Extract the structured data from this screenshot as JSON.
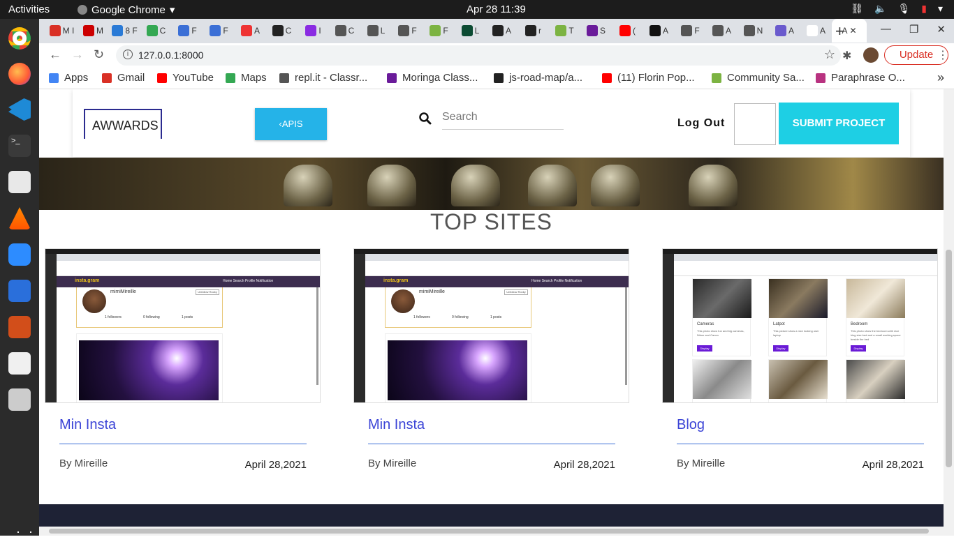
{
  "os": {
    "activities": "Activities",
    "app_name": "Google Chrome",
    "datetime": "Apr 28  11:39"
  },
  "browser": {
    "url": "127.0.0.1:8000",
    "update_label": "Update",
    "tabs": [
      "M I",
      "M",
      "8 F",
      "C",
      "F",
      "F",
      "A",
      "C",
      "I",
      "C",
      "L",
      "F",
      "F",
      "L",
      "A",
      "r",
      "T",
      "S",
      "(",
      "A",
      "F",
      "A",
      "N",
      "A",
      "A"
    ],
    "active_tab": "A"
  },
  "bookmarks": [
    {
      "label": "Apps",
      "icon": "apps-grid-icon",
      "color": "#4285f4"
    },
    {
      "label": "Gmail",
      "icon": "gmail-icon",
      "color": "#d93025"
    },
    {
      "label": "YouTube",
      "icon": "youtube-icon",
      "color": "#ff0000"
    },
    {
      "label": "Maps",
      "icon": "maps-icon",
      "color": "#34a853"
    },
    {
      "label": "repl.it - Classr...",
      "icon": "replit-icon",
      "color": "#555555"
    },
    {
      "label": "Moringa Class...",
      "icon": "moringa-icon",
      "color": "#6a1b9a"
    },
    {
      "label": "js-road-map/a...",
      "icon": "github-icon",
      "color": "#222222"
    },
    {
      "label": "(11) Florin Pop...",
      "icon": "youtube-icon",
      "color": "#ff0000"
    },
    {
      "label": "Community Sa...",
      "icon": "community-icon",
      "color": "#7cb342"
    },
    {
      "label": "Paraphrase O...",
      "icon": "paraphrase-icon",
      "color": "#b83280"
    }
  ],
  "site": {
    "logo": "AWWARDS",
    "apis_button": "APIS",
    "search_placeholder": "Search",
    "logout": "Log Out",
    "submit_button": "SUBMIT PROJECT",
    "section_title": "TOP SITES",
    "projects": [
      {
        "title": "Min Insta",
        "author": "By Mireille",
        "date": "April 28,2021",
        "shot_kind": "insta"
      },
      {
        "title": "Min Insta",
        "author": "By Mireille",
        "date": "April 28,2021",
        "shot_kind": "insta"
      },
      {
        "title": "Blog",
        "author": "By Mireille",
        "date": "April 28,2021",
        "shot_kind": "blog"
      }
    ],
    "insta_shot": {
      "brand": "insta.gram",
      "nav_links": "Home  Search  Profile  Notification",
      "username": "mimiMireille",
      "edit_button": "Unfollow Rocky",
      "followers": "1 followers",
      "following": "0 following",
      "posts": "1 posts"
    },
    "blog_shot": {
      "items": [
        {
          "title": "Cameras",
          "text": "This photo show fun and big cameras, Nikon and Canon",
          "button": "Display"
        },
        {
          "title": "Latpot",
          "text": "This picture show a nice looking user laptop",
          "button": "Display"
        },
        {
          "title": "Bedroom",
          "text": "This photo show the bedroom with nice king size bed and a small working space beside the bed",
          "button": "Display"
        }
      ]
    }
  },
  "colors": {
    "accent_blue": "#25b3e8",
    "submit_cyan": "#1ecfe4",
    "link_blue": "#3b44d6",
    "footer": "#1e2235"
  }
}
